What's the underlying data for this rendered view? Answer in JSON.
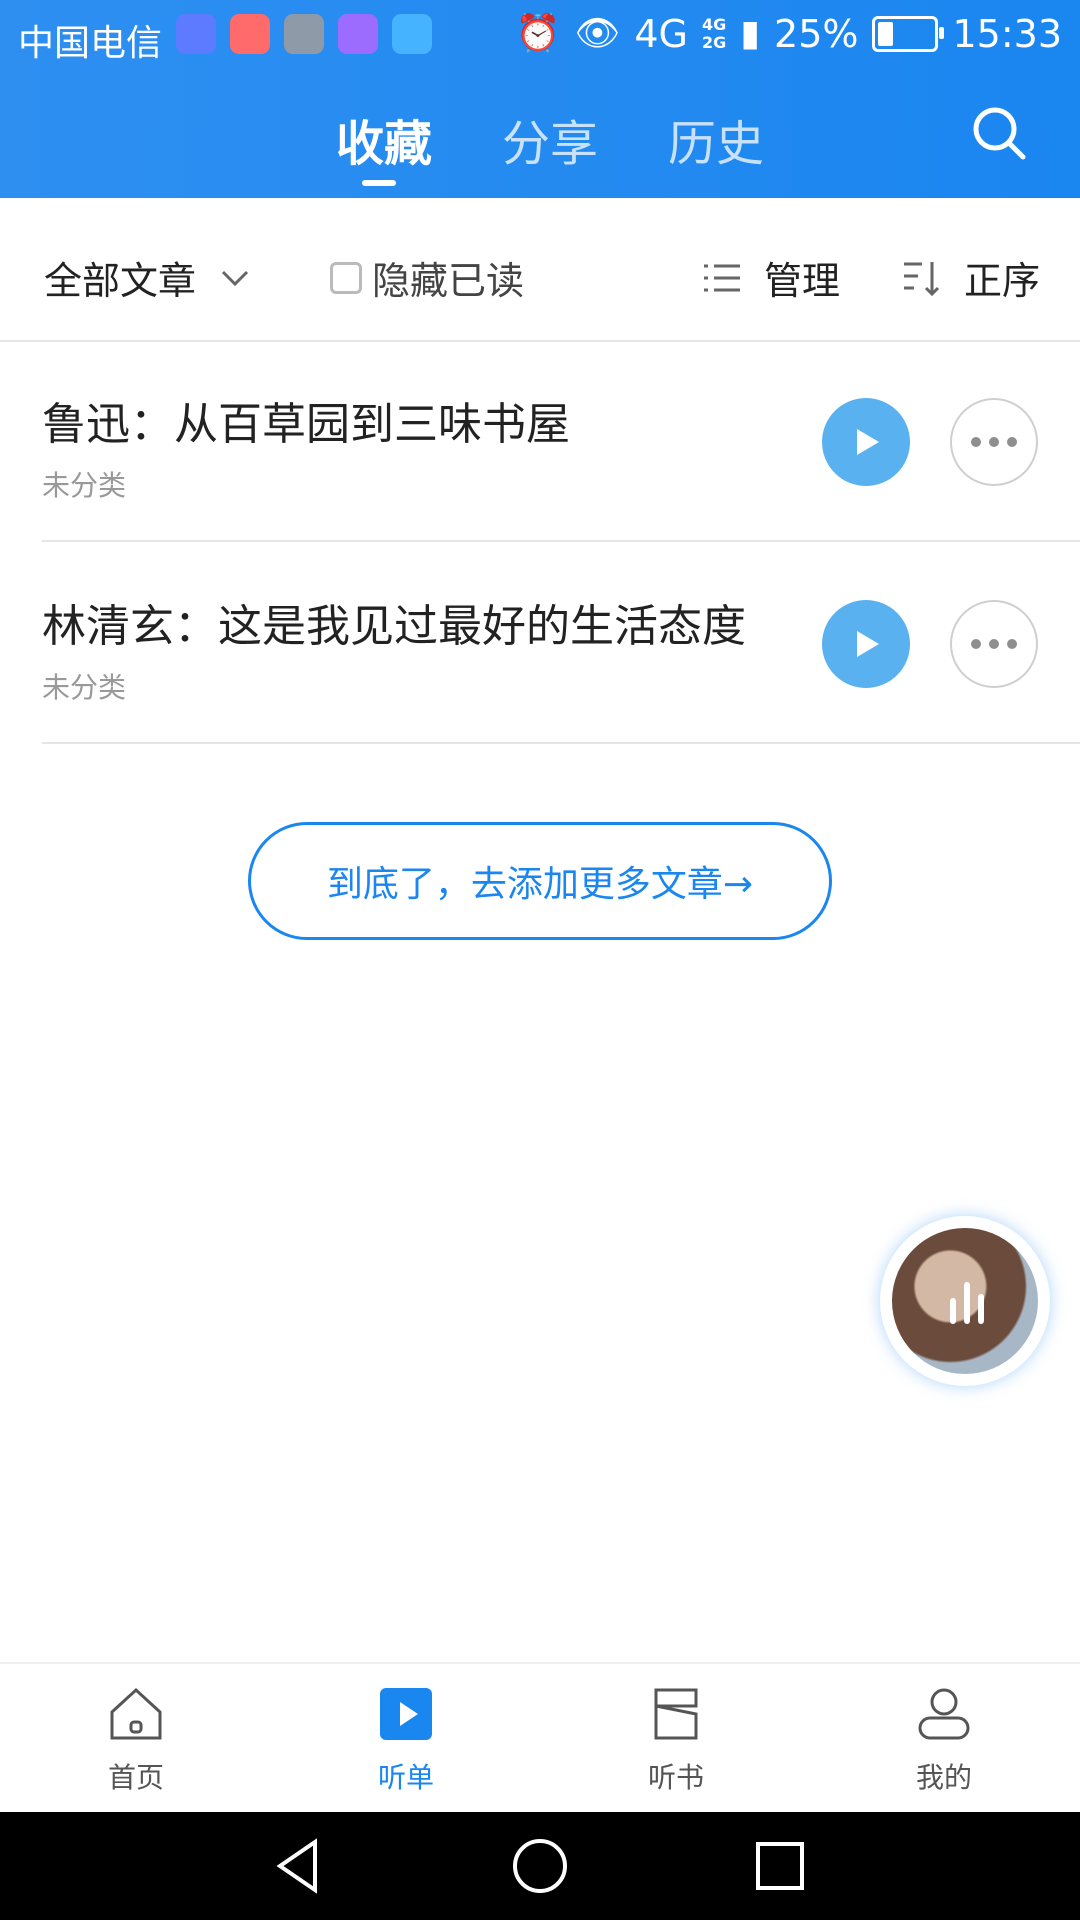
{
  "status_bar": {
    "carrier": "中国电信",
    "network": "4G",
    "network_small_top": "4G",
    "network_small_bottom": "2G",
    "battery": "25%",
    "time": "15:33",
    "app_icon_colors": [
      "#5c7bff",
      "#ff6b6b",
      "#8e9aa8",
      "#9b6cff",
      "#45b3ff"
    ],
    "battery_level": 25
  },
  "header": {
    "tabs": [
      {
        "label": "收藏"
      },
      {
        "label": "分享"
      },
      {
        "label": "历史"
      }
    ],
    "search_icon": "search-icon"
  },
  "toolbar": {
    "filter_label": "全部文章",
    "hide_read_label": "隐藏已读",
    "manage_label": "管理",
    "sort_label": "正序"
  },
  "articles": [
    {
      "title": "鲁迅：从百草园到三味书屋",
      "category": "未分类"
    },
    {
      "title": "林清玄：这是我见过最好的生活态度",
      "category": "未分类"
    }
  ],
  "list_end_cta": "到底了，去添加更多文章→",
  "bottom_nav": [
    {
      "label": "首页",
      "icon": "home-icon"
    },
    {
      "label": "听单",
      "icon": "play-square-icon"
    },
    {
      "label": "听书",
      "icon": "book-icon"
    },
    {
      "label": "我的",
      "icon": "user-icon"
    }
  ],
  "colors": {
    "primary": "#1a86f0",
    "play_button": "#5ab1f0",
    "muted": "#999999"
  }
}
